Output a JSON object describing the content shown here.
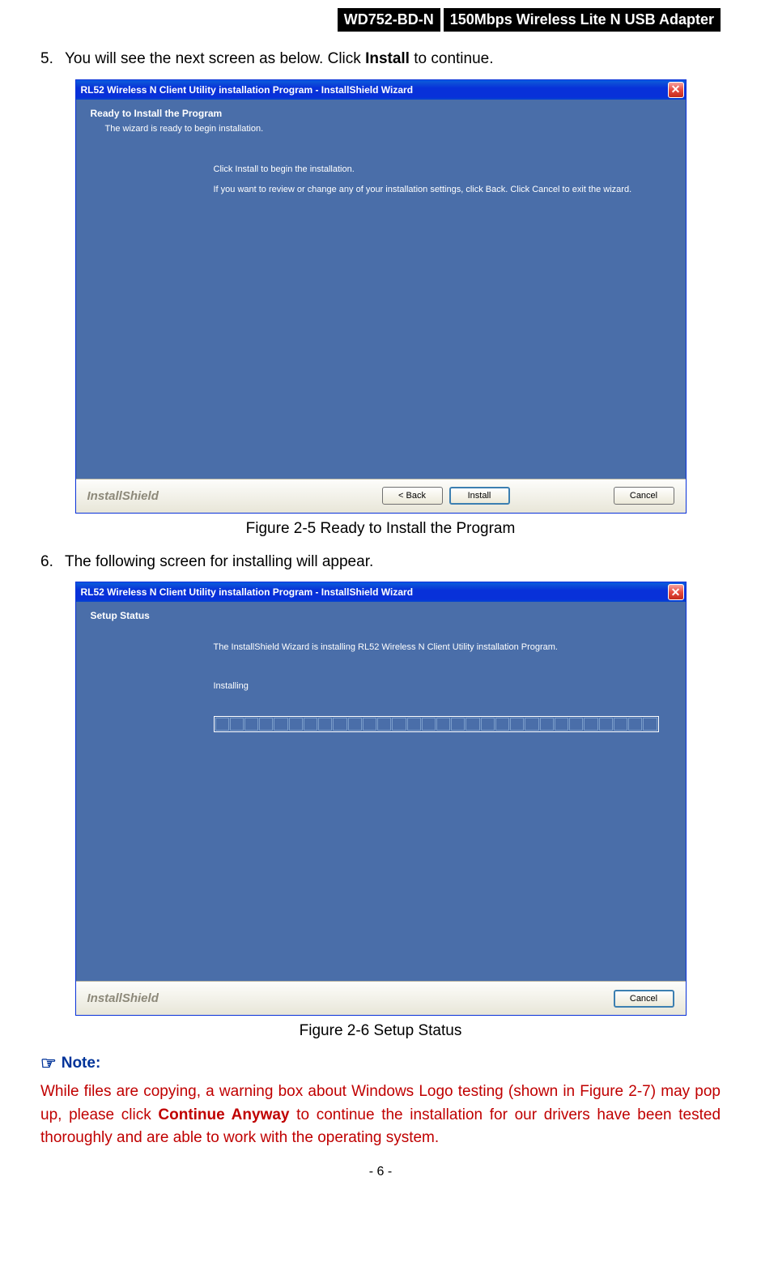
{
  "header": {
    "model": "WD752-BD-N",
    "description": "150Mbps Wireless Lite N USB Adapter"
  },
  "step5": {
    "number": "5.",
    "text_before": "You will see the next screen as below. Click ",
    "text_bold": "Install",
    "text_after": " to continue."
  },
  "dialog1": {
    "title": "RL52 Wireless N Client Utility installation Program - InstallShield Wizard",
    "heading": "Ready to Install the Program",
    "subtext": "The wizard is ready to begin installation.",
    "line1": "Click Install to begin the installation.",
    "line2": "If you want to review or change any of your installation settings, click Back. Click Cancel to exit the wizard.",
    "brand": "InstallShield",
    "back_btn": "< Back",
    "install_btn": "Install",
    "cancel_btn": "Cancel"
  },
  "figure1_caption": "Figure 2-5 Ready to Install the Program",
  "step6": {
    "number": "6.",
    "text": "The following screen for installing will appear."
  },
  "dialog2": {
    "title": "RL52 Wireless N Client Utility installation Program - InstallShield Wizard",
    "heading": "Setup Status",
    "line1": "The InstallShield Wizard is installing RL52 Wireless N Client Utility installation Program.",
    "line2": "Installing",
    "brand": "InstallShield",
    "cancel_btn": "Cancel"
  },
  "figure2_caption": "Figure 2-6 Setup Status",
  "note": {
    "heading": "Note:",
    "body_before": "While files are copying, a warning box about Windows Logo testing (shown in Figure 2-7) may pop up, please click ",
    "body_bold": "Continue Anyway",
    "body_after": " to continue the installation for our drivers have been tested thoroughly and are able to work with the operating system."
  },
  "page_number": "- 6 -"
}
